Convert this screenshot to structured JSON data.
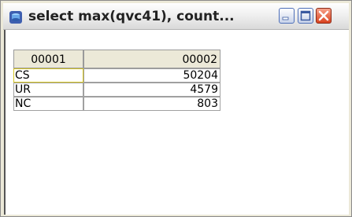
{
  "window": {
    "title": "select max(qvc41), count..."
  },
  "table": {
    "headers": [
      "00001",
      "00002"
    ],
    "rows": [
      [
        "CS",
        "50204"
      ],
      [
        "UR",
        "4579"
      ],
      [
        "NC",
        "803"
      ]
    ]
  }
}
